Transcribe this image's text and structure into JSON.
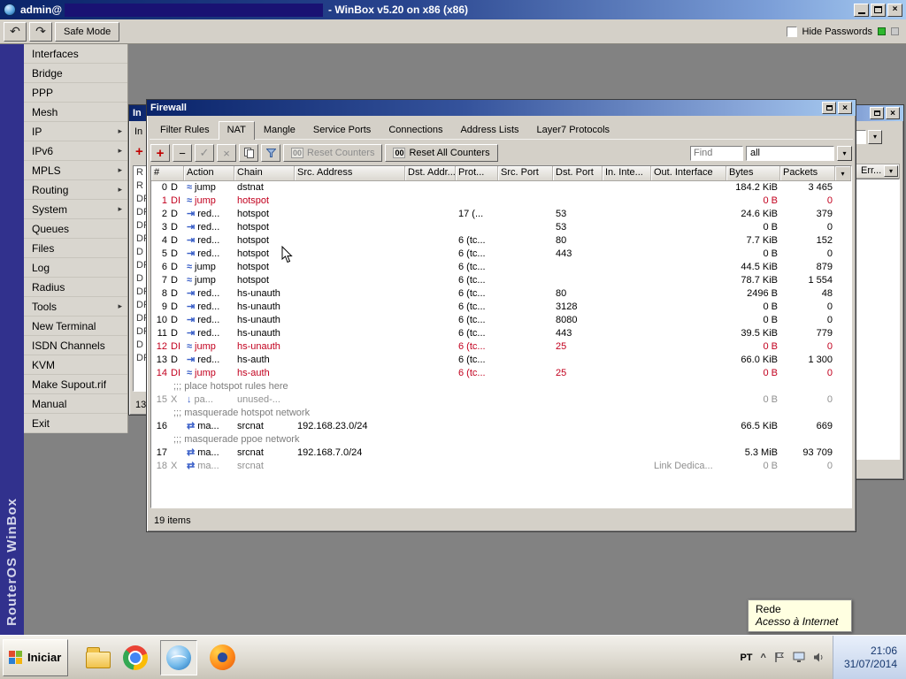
{
  "app": {
    "titlebar": {
      "prefix": "admin@",
      "suffix": "- WinBox v5.20 on x86 (x86)"
    },
    "toolbar": {
      "undo_icon": "↶",
      "redo_icon": "↷",
      "safe_mode_label": "Safe Mode",
      "hide_passwords_label": "Hide Passwords"
    },
    "brand_vertical": "RouterOS WinBox"
  },
  "sidebar": {
    "items": [
      {
        "label": "Interfaces",
        "submenu": false
      },
      {
        "label": "Bridge",
        "submenu": false
      },
      {
        "label": "PPP",
        "submenu": false
      },
      {
        "label": "Mesh",
        "submenu": false
      },
      {
        "label": "IP",
        "submenu": true
      },
      {
        "label": "IPv6",
        "submenu": true
      },
      {
        "label": "MPLS",
        "submenu": true
      },
      {
        "label": "Routing",
        "submenu": true
      },
      {
        "label": "System",
        "submenu": true
      },
      {
        "label": "Queues",
        "submenu": false
      },
      {
        "label": "Files",
        "submenu": false
      },
      {
        "label": "Log",
        "submenu": false
      },
      {
        "label": "Radius",
        "submenu": false
      },
      {
        "label": "Tools",
        "submenu": true
      },
      {
        "label": "New Terminal",
        "submenu": false
      },
      {
        "label": "ISDN Channels",
        "submenu": false
      },
      {
        "label": "KVM",
        "submenu": false
      },
      {
        "label": "Make Supout.rif",
        "submenu": false
      },
      {
        "label": "Manual",
        "submenu": false
      },
      {
        "label": "Exit",
        "submenu": false
      }
    ]
  },
  "left_window": {
    "title": "In",
    "tab_label": "In",
    "add_icon": "+",
    "flags": [
      "R",
      "R",
      "DR",
      "DR",
      "DR",
      "DR",
      "D",
      "DR",
      "D",
      "DR",
      "DR",
      "DR",
      "DR",
      "D",
      "DR"
    ],
    "status": "13"
  },
  "right_window": {
    "column_header": "Err...",
    "column_button_icon": "▾"
  },
  "firewall": {
    "title": "Firewall",
    "tabs": [
      "Filter Rules",
      "NAT",
      "Mangle",
      "Service Ports",
      "Connections",
      "Address Lists",
      "Layer7 Protocols"
    ],
    "active_tab": "NAT",
    "toolbar": {
      "add_icon": "+",
      "remove_icon": "−",
      "enable_icon": "✓",
      "disable_icon": "×",
      "counter_icon": "00",
      "reset_counters_label": "Reset Counters",
      "reset_all_counters_label": "Reset All Counters",
      "find_placeholder": "Find",
      "filter_value": "all",
      "combo_arrow_icon": "▾"
    },
    "columns": [
      "#",
      "Action",
      "Chain",
      "Src. Address",
      "Dst. Addr...",
      "Prot...",
      "Src. Port",
      "Dst. Port",
      "In. Inte...",
      "Out. Interface",
      "Bytes",
      "Packets"
    ],
    "column_select_icon": "▾",
    "action_icons": {
      "jump": "≈",
      "redirect": "⇥",
      "masquerade": "⇄",
      "passthrough": "↓"
    },
    "rows": [
      {
        "n": "0",
        "f": "D",
        "icon": "jump",
        "action": "jump",
        "chain": "dstnat",
        "bytes": "184.2 KiB",
        "packets": "3 465"
      },
      {
        "n": "1",
        "f": "DI",
        "icon": "jump",
        "action": "jump",
        "chain": "hotspot",
        "bytes": "0 B",
        "packets": "0",
        "state": "disabled"
      },
      {
        "n": "2",
        "f": "D",
        "icon": "redirect",
        "action": "red...",
        "chain": "hotspot",
        "proto": "17 (...",
        "dport": "53",
        "bytes": "24.6 KiB",
        "packets": "379"
      },
      {
        "n": "3",
        "f": "D",
        "icon": "redirect",
        "action": "red...",
        "chain": "hotspot",
        "dport": "53",
        "bytes": "0 B",
        "packets": "0"
      },
      {
        "n": "4",
        "f": "D",
        "icon": "redirect",
        "action": "red...",
        "chain": "hotspot",
        "proto": "6 (tc...",
        "dport": "80",
        "bytes": "7.7 KiB",
        "packets": "152"
      },
      {
        "n": "5",
        "f": "D",
        "icon": "redirect",
        "action": "red...",
        "chain": "hotspot",
        "proto": "6 (tc...",
        "dport": "443",
        "bytes": "0 B",
        "packets": "0"
      },
      {
        "n": "6",
        "f": "D",
        "icon": "jump",
        "action": "jump",
        "chain": "hotspot",
        "proto": "6 (tc...",
        "bytes": "44.5 KiB",
        "packets": "879"
      },
      {
        "n": "7",
        "f": "D",
        "icon": "jump",
        "action": "jump",
        "chain": "hotspot",
        "proto": "6 (tc...",
        "bytes": "78.7 KiB",
        "packets": "1 554"
      },
      {
        "n": "8",
        "f": "D",
        "icon": "redirect",
        "action": "red...",
        "chain": "hs-unauth",
        "proto": "6 (tc...",
        "dport": "80",
        "bytes": "2496 B",
        "packets": "48"
      },
      {
        "n": "9",
        "f": "D",
        "icon": "redirect",
        "action": "red...",
        "chain": "hs-unauth",
        "proto": "6 (tc...",
        "dport": "3128",
        "bytes": "0 B",
        "packets": "0"
      },
      {
        "n": "10",
        "f": "D",
        "icon": "redirect",
        "action": "red...",
        "chain": "hs-unauth",
        "proto": "6 (tc...",
        "dport": "8080",
        "bytes": "0 B",
        "packets": "0"
      },
      {
        "n": "11",
        "f": "D",
        "icon": "redirect",
        "action": "red...",
        "chain": "hs-unauth",
        "proto": "6 (tc...",
        "dport": "443",
        "bytes": "39.5 KiB",
        "packets": "779"
      },
      {
        "n": "12",
        "f": "DI",
        "icon": "jump",
        "action": "jump",
        "chain": "hs-unauth",
        "proto": "6 (tc...",
        "dport": "25",
        "bytes": "0 B",
        "packets": "0",
        "state": "disabled"
      },
      {
        "n": "13",
        "f": "D",
        "icon": "redirect",
        "action": "red...",
        "chain": "hs-auth",
        "proto": "6 (tc...",
        "bytes": "66.0 KiB",
        "packets": "1 300"
      },
      {
        "n": "14",
        "f": "DI",
        "icon": "jump",
        "action": "jump",
        "chain": "hs-auth",
        "proto": "6 (tc...",
        "dport": "25",
        "bytes": "0 B",
        "packets": "0",
        "state": "disabled"
      },
      {
        "comment": ";;; place hotspot rules here"
      },
      {
        "n": "15",
        "f": "X",
        "icon": "passthrough",
        "action": "pa...",
        "chain": "unused-...",
        "bytes": "0 B",
        "packets": "0",
        "state": "inactive"
      },
      {
        "comment": ";;; masquerade hotspot network"
      },
      {
        "n": "16",
        "icon": "masquerade",
        "action": "ma...",
        "chain": "srcnat",
        "src": "192.168.23.0/24",
        "bytes": "66.5 KiB",
        "packets": "669"
      },
      {
        "comment": ";;; masquerade ppoe network"
      },
      {
        "n": "17",
        "icon": "masquerade",
        "action": "ma...",
        "chain": "srcnat",
        "src": "192.168.7.0/24",
        "bytes": "5.3 MiB",
        "packets": "93 709"
      },
      {
        "n": "18",
        "f": "X",
        "icon": "masquerade",
        "action": "ma...",
        "chain": "srcnat",
        "outif": "Link Dedica...",
        "bytes": "0 B",
        "packets": "0",
        "state": "inactive"
      }
    ],
    "status": "19 items"
  },
  "tooltip": {
    "title": "Rede",
    "subtitle": "Acesso à Internet"
  },
  "taskbar": {
    "start_label": "Iniciar",
    "language": "PT",
    "chevron": "^",
    "time": "21:06",
    "date": "31/07/2014"
  }
}
